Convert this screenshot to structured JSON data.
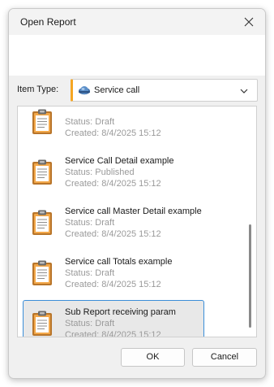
{
  "window": {
    "title": "Open Report",
    "close_icon": "close-icon"
  },
  "filter": {
    "label": "Item Type:",
    "selected_value": "Service call",
    "selected_icon": "service-call-icon",
    "accent_color": "#f5a623"
  },
  "list": {
    "items": [
      {
        "title": "",
        "status": "Status: Draft",
        "created": "Created: 8/4/2025 15:12",
        "icon": "clipboard-icon",
        "selected": false
      },
      {
        "title": "Service Call Detail example",
        "status": "Status: Published",
        "created": "Created: 8/4/2025 15:12",
        "icon": "clipboard-icon",
        "selected": false
      },
      {
        "title": "Service call Master Detail example",
        "status": "Status: Draft",
        "created": "Created: 8/4/2025 15:12",
        "icon": "clipboard-icon",
        "selected": false
      },
      {
        "title": "Service call Totals example",
        "status": "Status: Draft",
        "created": "Created: 8/4/2025 15:12",
        "icon": "clipboard-icon",
        "selected": false
      },
      {
        "title": "Sub Report receiving param",
        "status": "Status: Draft",
        "created": "Created: 8/4/2025 15:12",
        "icon": "clipboard-icon",
        "selected": true
      }
    ],
    "selection_color": "#3b8ed8"
  },
  "buttons": {
    "ok_label": "OK",
    "cancel_label": "Cancel"
  }
}
